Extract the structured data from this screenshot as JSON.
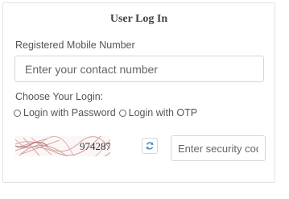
{
  "form": {
    "title": "User Log In",
    "mobile_label": "Registered Mobile Number",
    "mobile_placeholder": "Enter your contact number",
    "login_label": "Choose Your Login:",
    "option_password": "Login with Password",
    "option_otp": "Login with OTP",
    "captcha_text": "974287",
    "security_placeholder": "Enter security code"
  },
  "icons": {
    "refresh": "refresh-icon",
    "accent_color": "#3a8fb7"
  }
}
